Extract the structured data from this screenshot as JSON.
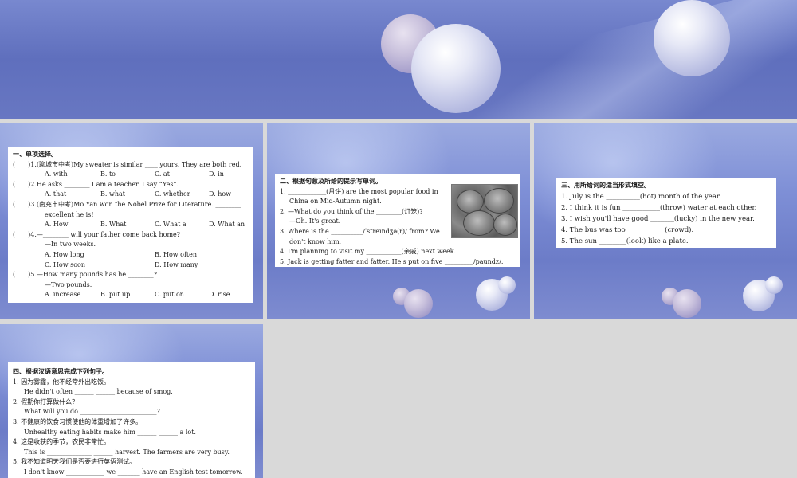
{
  "section1": {
    "heading": "一、单项选择。",
    "items": [
      {
        "paren": "(　　)",
        "num": "1.",
        "source": "(聊城市中考)",
        "text": "My sweater is similar ____ yours. They are both red.",
        "options": [
          "A. with",
          "B. to",
          "C. at",
          "D. in"
        ]
      },
      {
        "paren": "(　　)",
        "num": "2.",
        "text": "He asks ________ I am a teacher. I say “Yes”.",
        "options": [
          "A. that",
          "B. what",
          "C. whether",
          "D. how"
        ]
      },
      {
        "paren": "(　　)",
        "num": "3.",
        "source": "(南充市中考)",
        "text": "Mo Yan won the Nobel Prize for Literature. ________",
        "text2": "excellent he is!",
        "options": [
          "A. How",
          "B. What",
          "C. What a",
          "D. What an"
        ]
      },
      {
        "paren": "(　　)",
        "num": "4.",
        "text": "—________ will your father come back home?",
        "text2": "—In two weeks.",
        "options": [
          "A. How long",
          "B. How often",
          "C. How soon",
          "D. How many"
        ]
      },
      {
        "paren": "(　　)",
        "num": "5.",
        "text": "—How many pounds has he ________?",
        "text2": "—Two pounds.",
        "options": [
          "A. increase",
          "B. put up",
          "C. put on",
          "D. rise"
        ]
      }
    ]
  },
  "section2": {
    "heading": "二、根据句意及所给的提示写单词。",
    "lines": [
      "1. ____________(月饼) are the most popular food in",
      "China on Mid-Autumn night.",
      "2. —What do you think of the ________(灯笼)?",
      "—Oh. It's great.",
      "3. Where is the __________/ˈstreindʒə(r)/ from? We",
      "don't know him.",
      "4. I'm planning to visit my ___________(亲戚) next week.",
      "5. Jack is getting fatter and fatter. He's put on five _________/paundz/."
    ]
  },
  "section3": {
    "heading": "三、用所给词的适当形式填空。",
    "lines": [
      "1. July is the __________(hot) month of the year.",
      "2. I think it is fun ___________(throw) water at each other.",
      "3. I wish you'll have good _______(lucky) in the new year.",
      "4. The bus was too ___________(crowd).",
      "5. The sun ________(look) like a plate."
    ]
  },
  "section4": {
    "heading": "四、根据汉语意思完成下列句子。",
    "lines": [
      "1. 因为雾霾，他不经常外出吃饭。",
      "He didn't often ______ ______ because of smog.",
      "2. 假期你打算做什么？",
      "What will you do ________________________?",
      "3. 不健康的饮食习惯使他的体重增加了许多。",
      "Unhealthy eating habits make him ______ ______ a lot.",
      "4. 这是收获的季节，农民非常忙。",
      "This is ______________ ______ harvest.  The farmers are very busy.",
      "5. 我不知道明天我们是否要进行英语测试。",
      "I don't know ____________ we _______ have an English test tomorrow."
    ]
  }
}
